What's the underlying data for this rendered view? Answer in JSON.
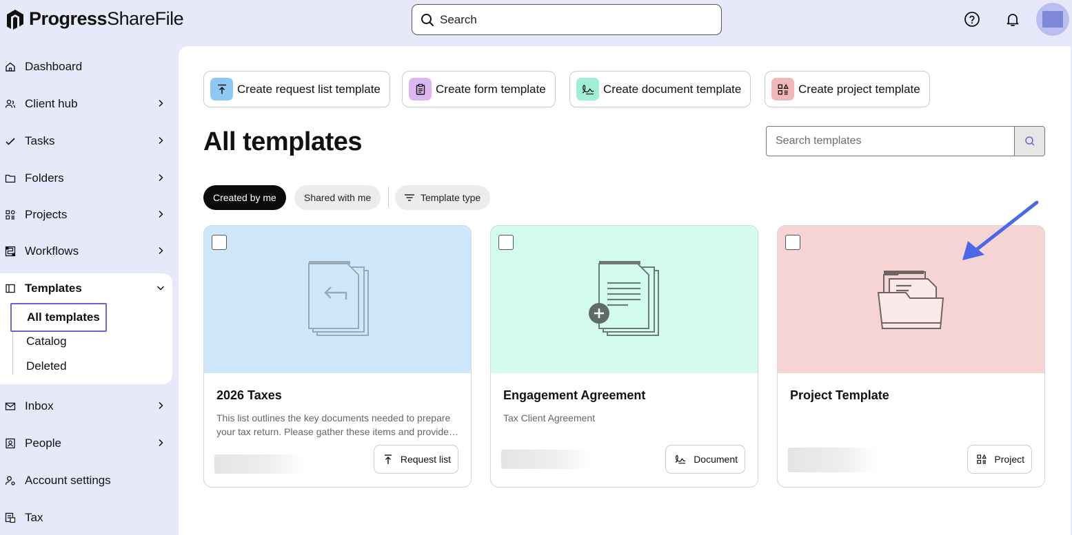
{
  "app": {
    "logo_brand": "Progress",
    "logo_product": "ShareFile",
    "search_placeholder": "Search"
  },
  "sidebar": {
    "items": [
      {
        "label": "Dashboard"
      },
      {
        "label": "Client hub"
      },
      {
        "label": "Tasks"
      },
      {
        "label": "Folders"
      },
      {
        "label": "Projects"
      },
      {
        "label": "Workflows"
      },
      {
        "label": "Templates"
      },
      {
        "label": "Inbox"
      },
      {
        "label": "People"
      },
      {
        "label": "Account settings"
      },
      {
        "label": "Tax"
      }
    ],
    "templates_sub": [
      {
        "label": "All templates"
      },
      {
        "label": "Catalog"
      },
      {
        "label": "Deleted"
      }
    ]
  },
  "create_buttons": [
    {
      "label": "Create request list template",
      "color": "#8ec9f5"
    },
    {
      "label": "Create form template",
      "color": "#dcb7f2"
    },
    {
      "label": "Create document template",
      "color": "#9ff0d6"
    },
    {
      "label": "Create project template",
      "color": "#f2b8b8"
    }
  ],
  "page": {
    "title": "All templates",
    "search_placeholder": "Search templates"
  },
  "filters": {
    "created_by_me": "Created by me",
    "shared_with_me": "Shared with me",
    "template_type": "Template type"
  },
  "cards": [
    {
      "title": "2026 Taxes",
      "description": "This list outlines the key documents needed to prepare your tax return. Please gather these items and provide them at your earliest convenience.",
      "type": "Request list",
      "banner_color": "#cfe7fb"
    },
    {
      "title": "Engagement Agreement",
      "description": "Tax Client Agreement",
      "type": "Document",
      "banner_color": "#d3fcec"
    },
    {
      "title": "Project Template",
      "description": "",
      "type": "Project",
      "banner_color": "#f7d4d4"
    }
  ],
  "colors": {
    "accent": "#6c62d8",
    "arrow": "#4a68e8"
  }
}
